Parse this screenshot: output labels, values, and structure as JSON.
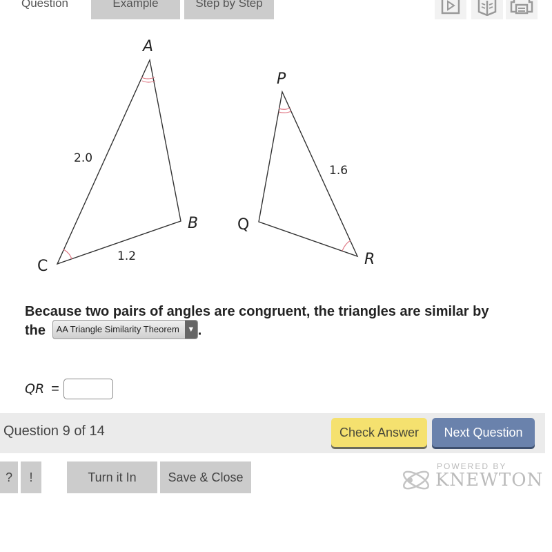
{
  "tabs": [
    {
      "label": "Question",
      "active": true
    },
    {
      "label": "Example",
      "active": false
    },
    {
      "label": "Step by Step",
      "active": false
    }
  ],
  "tools": [
    {
      "icon": "play-video-icon"
    },
    {
      "icon": "open-book-icon"
    },
    {
      "icon": "print-icon"
    }
  ],
  "figure": {
    "triangle1": {
      "vertices": [
        "A",
        "B",
        "C"
      ],
      "sides": {
        "AC": "2.0",
        "CB": "1.2"
      },
      "marked_angles": [
        "A (double arc)",
        "C (single arc)"
      ]
    },
    "triangle2": {
      "vertices": [
        "P",
        "Q",
        "R"
      ],
      "sides": {
        "PR": "1.6"
      },
      "marked_angles": [
        "P (double arc)",
        "R (single arc)"
      ]
    },
    "arc_color": "#e07a86"
  },
  "question": {
    "text_line1": "Because two pairs of angles are congruent, the triangles are similar by",
    "text_the": "the",
    "select_value": "AA Triangle Similarity Theorem",
    "text_end": ".",
    "answer_label": "QR",
    "answer_equals": "=",
    "answer_value": ""
  },
  "status": {
    "question_word": "Question",
    "current": "9",
    "of_text": "of 14"
  },
  "buttons": {
    "check_answer": "Check Answer",
    "next_question": "Next Question",
    "help": "?",
    "alert": "!",
    "turn_in": "Turn it In",
    "save_close": "Save & Close"
  },
  "branding": {
    "powered_by": "POWERED BY",
    "name": "KNEWTON"
  },
  "colors": {
    "check_answer_bg": "#f5e16f",
    "next_question_bg": "#6a82ac",
    "gray_button_bg": "#cccccc",
    "status_bar_bg": "#ebebeb"
  }
}
